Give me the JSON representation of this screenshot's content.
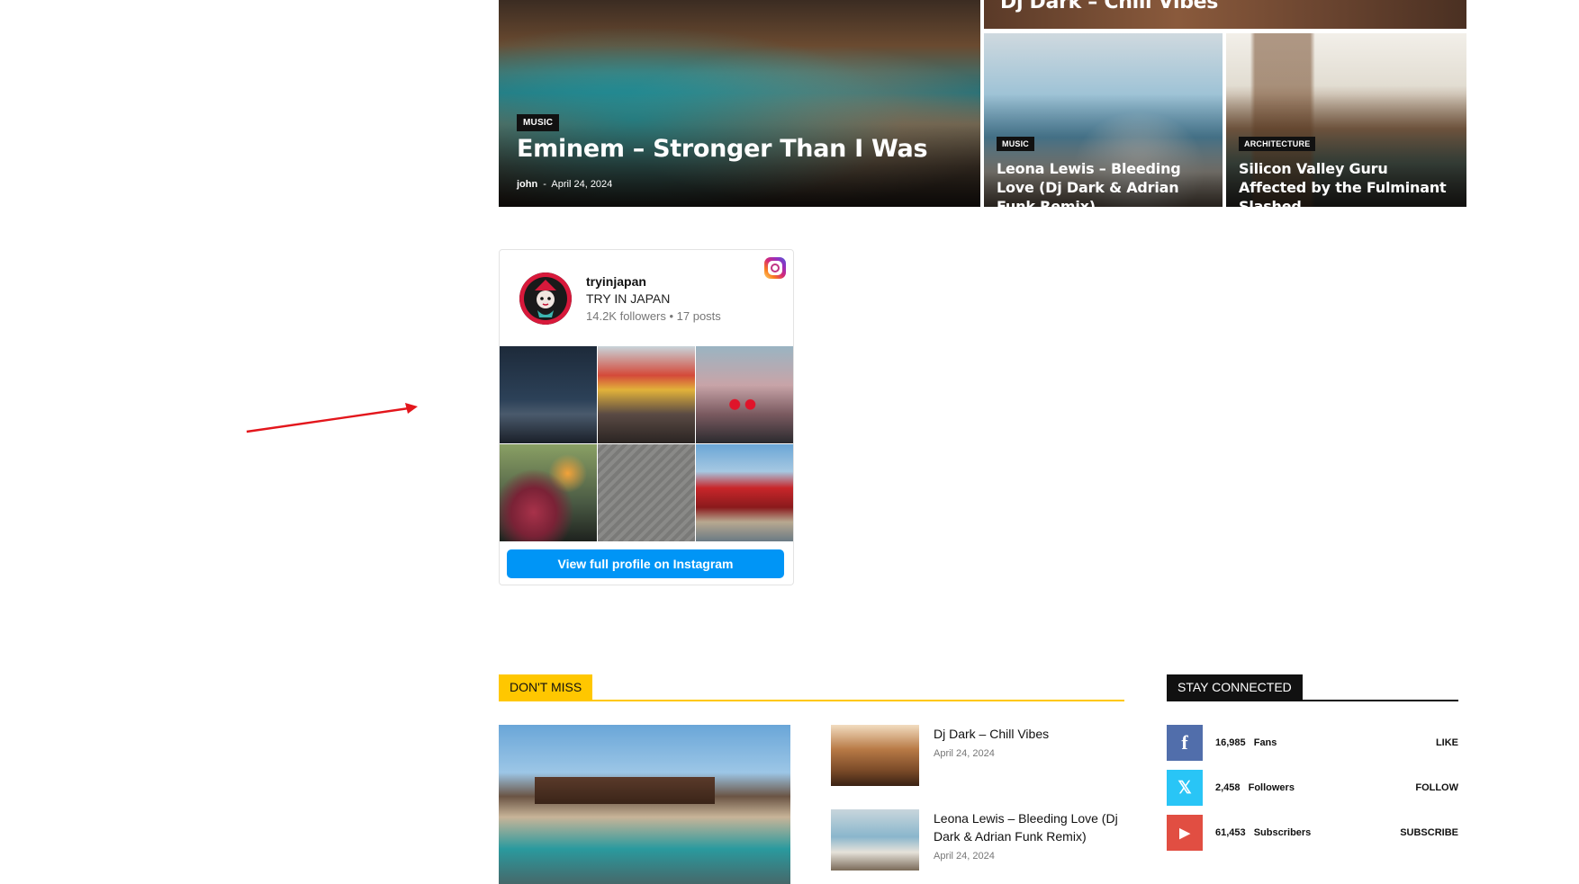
{
  "featured": {
    "main": {
      "category": "MUSIC",
      "title": "Eminem – Stronger Than I Was",
      "author": "john",
      "separator": "-",
      "date": "April 24, 2024"
    },
    "top_right": {
      "title": "Dj Dark – Chill Vibes"
    },
    "small_left": {
      "category": "MUSIC",
      "title": "Leona Lewis – Bleeding Love (Dj Dark & Adrian Funk Remix)"
    },
    "small_right": {
      "category": "ARCHITECTURE",
      "title": "Silicon Valley Guru Affected by the Fulminant Slashed"
    }
  },
  "instagram": {
    "username": "tryinjapan",
    "display_name": "TRY IN JAPAN",
    "stats": "14.2K followers • 17 posts",
    "button_label": "View full profile on Instagram"
  },
  "dont_miss": {
    "heading": "DON'T MISS",
    "items": [
      {
        "title": "Dj Dark – Chill Vibes",
        "date": "April 24, 2024"
      },
      {
        "title": "Leona Lewis – Bleeding Love (Dj Dark & Adrian Funk Remix)",
        "date": "April 24, 2024"
      }
    ]
  },
  "stay_connected": {
    "heading": "STAY CONNECTED",
    "rows": [
      {
        "icon": "facebook-icon",
        "glyph": "f",
        "color": "#516eab",
        "count": "16,985",
        "unit": "Fans",
        "action": "LIKE"
      },
      {
        "icon": "x-twitter-icon",
        "glyph": "𝕏",
        "color": "#29c5f6",
        "count": "2,458",
        "unit": "Followers",
        "action": "FOLLOW"
      },
      {
        "icon": "youtube-icon",
        "glyph": "▶",
        "color": "#e14e42",
        "count": "61,453",
        "unit": "Subscribers",
        "action": "SUBSCRIBE"
      }
    ]
  },
  "colors": {
    "accent": "#ffc700",
    "dark": "#111111",
    "instagram_blue": "#0095f6"
  }
}
